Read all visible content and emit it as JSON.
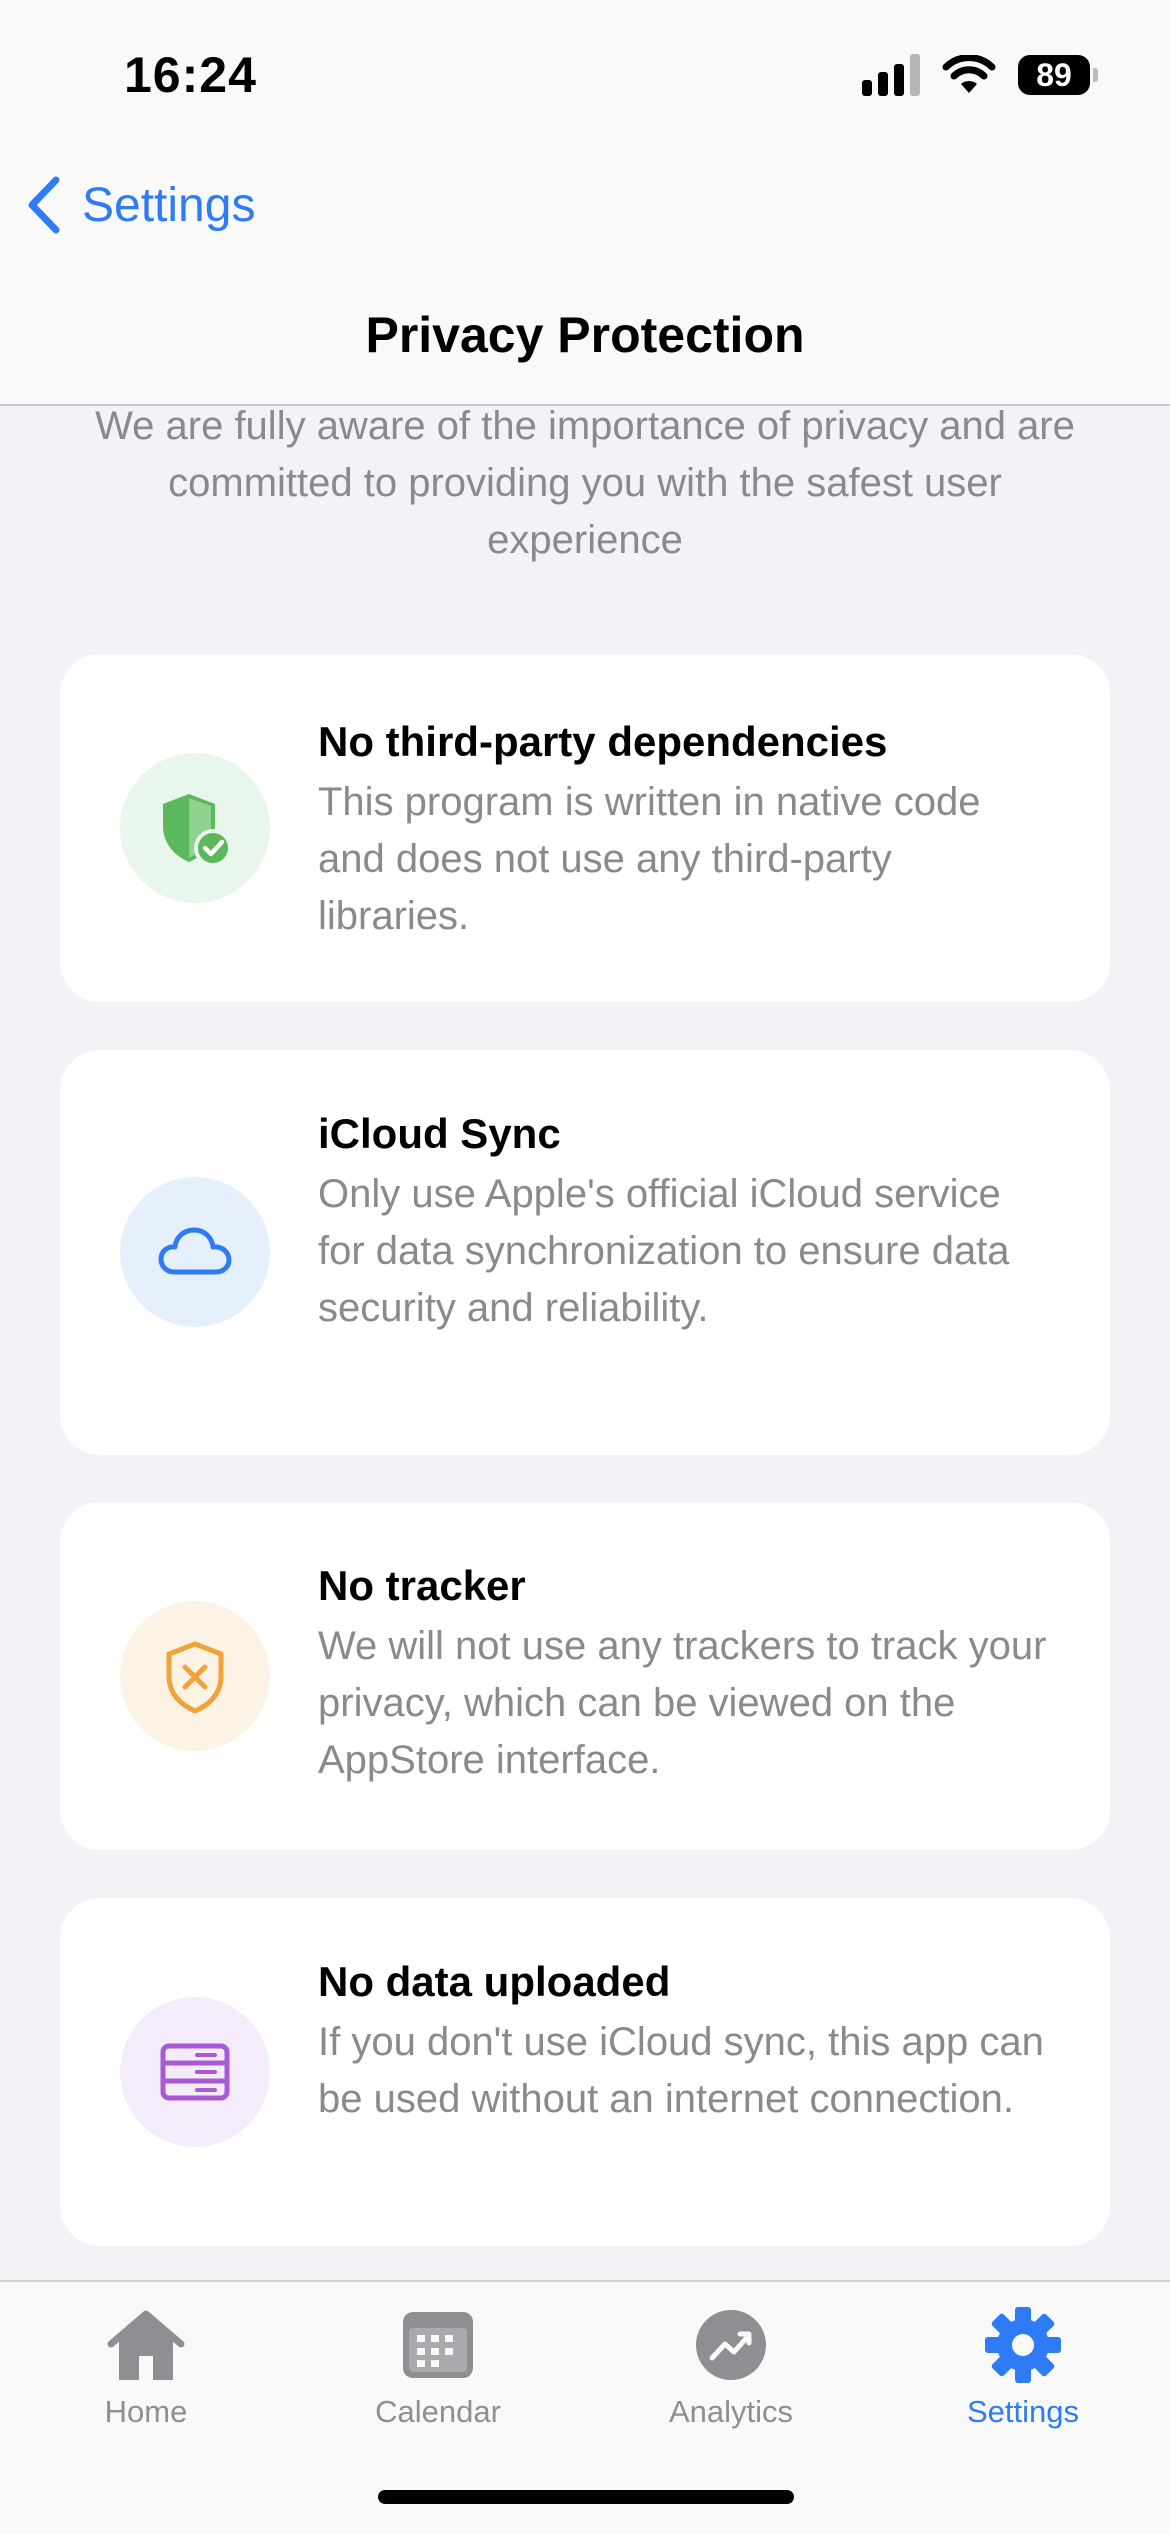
{
  "status_bar": {
    "time": "16:24",
    "battery": "89"
  },
  "nav": {
    "back_label": "Settings",
    "title": "Privacy Protection"
  },
  "intro": "We are fully aware of the importance of privacy and are committed to providing you with the safest user experience",
  "cards": [
    {
      "icon": "shield-check-icon",
      "accent": "#5cb85c",
      "bg": "#e9f6ec",
      "title": "No third-party dependencies",
      "description": "This program is written in native code and does not use any third-party libraries."
    },
    {
      "icon": "cloud-icon",
      "accent": "#2f7bf5",
      "bg": "#e6f0fd",
      "title": "iCloud Sync",
      "description": "Only use Apple's official iCloud service for data synchronization to ensure data security and reliability."
    },
    {
      "icon": "shield-x-icon",
      "accent": "#f0a23b",
      "bg": "#fdf3e5",
      "title": "No tracker",
      "description": "We will not use any trackers to track your privacy, which can be viewed on the AppStore interface."
    },
    {
      "icon": "server-icon",
      "accent": "#a85ad3",
      "bg": "#f4ebfb",
      "title": "No data uploaded",
      "description": "If you don't use iCloud sync, this app can be used without an internet connection."
    }
  ],
  "tabs": [
    {
      "label": "Home",
      "icon": "home-icon"
    },
    {
      "label": "Calendar",
      "icon": "calendar-icon"
    },
    {
      "label": "Analytics",
      "icon": "analytics-icon"
    },
    {
      "label": "Settings",
      "icon": "gear-icon",
      "active": true
    }
  ],
  "colors": {
    "accent": "#2f7bf5",
    "inactive_tab": "#8e8e93",
    "secondary_text": "#8a8a8e"
  }
}
